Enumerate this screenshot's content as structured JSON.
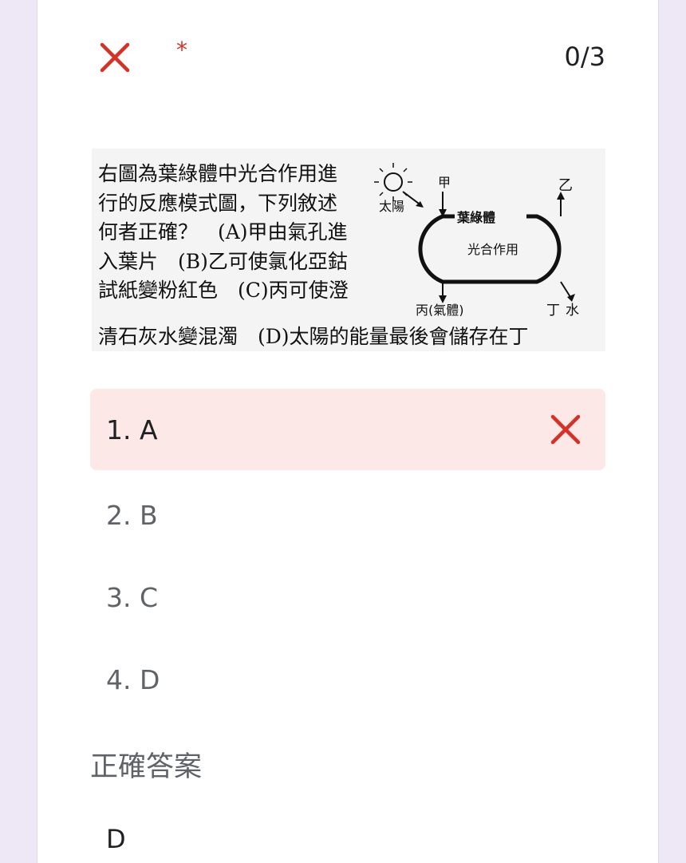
{
  "header": {
    "required_mark": "*",
    "score": "0/3",
    "status_icon": "close-icon",
    "status_color": "#d93025"
  },
  "question": {
    "text_lines": [
      "右圖為葉綠體中光合作用進",
      "行的反應模式圖，下列敘述",
      "何者正確？　(A)甲由氣孔進",
      "入葉片　(B)乙可使氯化亞鈷",
      "試紙變粉紅色　(C)丙可使澄"
    ],
    "last_line": "清石灰水變混濁　(D)太陽的能量最後會儲存在丁",
    "diagram": {
      "sun": "太陽",
      "jia": "甲",
      "yi": "乙",
      "chloroplast": "葉綠體",
      "process": "光合作用",
      "bing": "丙(氣體)",
      "ding": "丁",
      "water": "水"
    }
  },
  "options": [
    {
      "label": "1. A",
      "selected": true,
      "correct": false
    },
    {
      "label": "2. B",
      "selected": false,
      "correct": false
    },
    {
      "label": "3. C",
      "selected": false,
      "correct": false
    },
    {
      "label": "4. D",
      "selected": false,
      "correct": false
    }
  ],
  "feedback": {
    "correct_heading": "正確答案",
    "correct_answer": "D"
  },
  "colors": {
    "page_background": "#ede7f6",
    "wrong_highlight": "#fce8e6",
    "wrong_mark": "#d93025"
  }
}
